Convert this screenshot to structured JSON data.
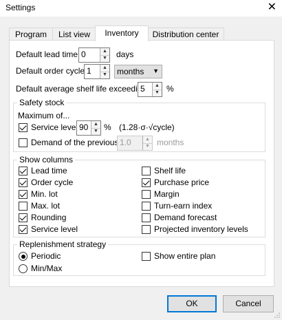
{
  "window": {
    "title": "Settings",
    "close_glyph": "✕"
  },
  "tabs": [
    {
      "label": "Program",
      "active": false
    },
    {
      "label": "List view",
      "active": false
    },
    {
      "label": "Inventory",
      "active": true
    },
    {
      "label": "Distribution center",
      "active": false
    }
  ],
  "lead_time": {
    "label": "Default lead time",
    "value": "0",
    "unit": "days"
  },
  "order_cycle": {
    "label": "Default order cycle",
    "value": "1",
    "unit_selected": "months"
  },
  "shelf_life": {
    "label": "Default average shelf life exceeding",
    "value": "5",
    "unit": "%"
  },
  "safety_stock": {
    "title": "Safety stock",
    "maximum_of": "Maximum of...",
    "service_level": {
      "label": "Service level",
      "checked": true,
      "value": "90",
      "unit": "%",
      "formula": "(1.28·σ·√cycle)"
    },
    "demand_previous": {
      "label": "Demand of the previous",
      "checked": false,
      "value": "1.0",
      "unit": "months"
    }
  },
  "show_columns": {
    "title": "Show columns",
    "left": [
      {
        "label": "Lead time",
        "checked": true
      },
      {
        "label": "Order cycle",
        "checked": true
      },
      {
        "label": "Min. lot",
        "checked": true
      },
      {
        "label": "Max. lot",
        "checked": false
      },
      {
        "label": "Rounding",
        "checked": true
      },
      {
        "label": "Service level",
        "checked": true
      }
    ],
    "right": [
      {
        "label": "Shelf life",
        "checked": false
      },
      {
        "label": "Purchase price",
        "checked": true
      },
      {
        "label": "Margin",
        "checked": false
      },
      {
        "label": "Turn-earn index",
        "checked": false
      },
      {
        "label": "Demand forecast",
        "checked": false
      },
      {
        "label": "Projected inventory levels",
        "checked": false
      }
    ]
  },
  "replenishment": {
    "title": "Replenishment strategy",
    "periodic": {
      "label": "Periodic",
      "selected": true
    },
    "minmax": {
      "label": "Min/Max",
      "selected": false
    },
    "show_entire_plan": {
      "label": "Show entire plan",
      "checked": false
    }
  },
  "buttons": {
    "ok": "OK",
    "cancel": "Cancel"
  },
  "spin_glyphs": {
    "up": "▲",
    "down": "▼",
    "dropdown": "▼"
  },
  "colors": {
    "accent": "#0078d7",
    "window_bg": "#f0f0f0",
    "panel_bg": "#ffffff"
  }
}
